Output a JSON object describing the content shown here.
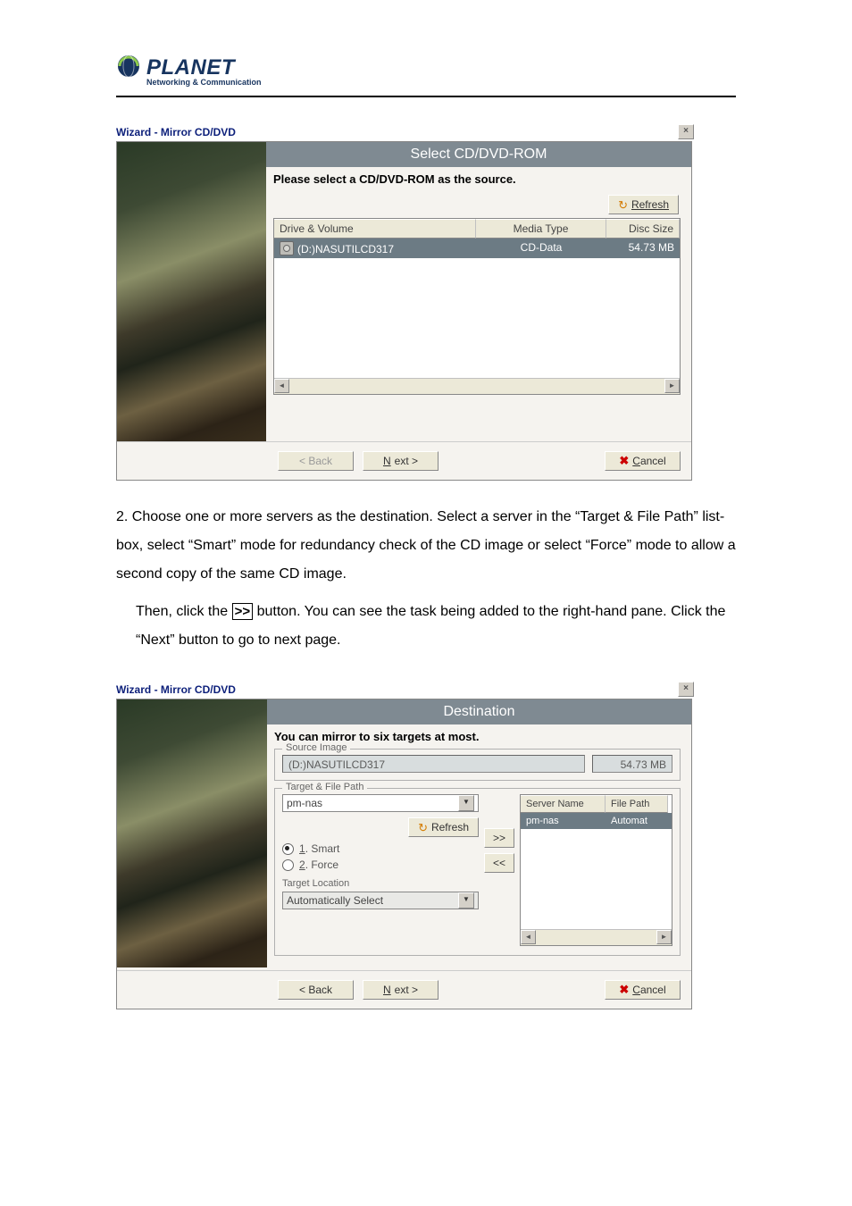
{
  "header": {
    "brand": "PLANET",
    "tagline": "Networking & Communication"
  },
  "screenshot1": {
    "window_title": "Wizard - Mirror CD/DVD",
    "banner": "Select  CD/DVD-ROM",
    "instruction": "Please select a CD/DVD-ROM as the source.",
    "refresh_label": "Refresh",
    "columns": {
      "a": "Drive & Volume",
      "b": "Media Type",
      "c": "Disc Size"
    },
    "row": {
      "a": "(D:)NASUTILCD317",
      "b": "CD-Data",
      "c": "54.73 MB"
    },
    "buttons": {
      "back": "< Back",
      "next": "Next >",
      "cancel": "Cancel"
    }
  },
  "paragraph_step2": {
    "lead": "2. Choose one or more servers as the destination. Select a server in the “Target & File Path” list-box, select “Smart” mode for redundancy check of the CD image or select “Force” mode to allow a second copy of the same CD image.",
    "then_a": "Then, click the ",
    "arrow": ">>",
    "then_b": " button. You can see the task being added to the right-hand pane. Click the “Next” button to go to next page."
  },
  "screenshot2": {
    "window_title": "Wizard - Mirror CD/DVD",
    "banner": "Destination",
    "instruction": "You can mirror to six targets at most.",
    "source_group": "Source Image",
    "source_value": "(D:)NASUTILCD317",
    "source_size": "54.73 MB",
    "target_group": "Target & File Path",
    "target_value": "pm-nas",
    "refresh_label": "Refresh",
    "radio1": "1. Smart",
    "radio2": "2. Force",
    "loc_label": "Target Location",
    "loc_value": "Automatically Select",
    "add_btn": ">>",
    "rem_btn": "<<",
    "grid_cols": {
      "a": "Server Name",
      "b": "File Path"
    },
    "grid_row": {
      "a": "pm-nas",
      "b": "Automat"
    },
    "buttons": {
      "back": "< Back",
      "next": "Next >",
      "cancel": "Cancel"
    }
  }
}
